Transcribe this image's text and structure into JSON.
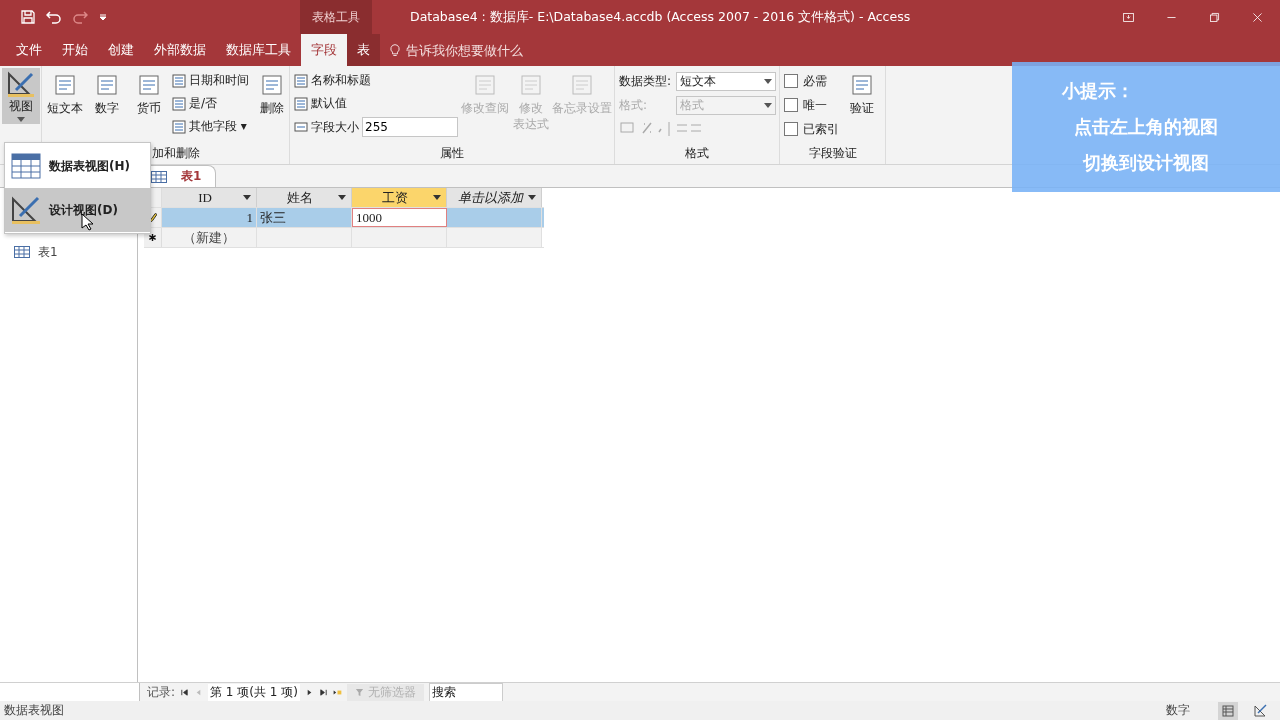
{
  "title_bar": {
    "context_group": "表格工具",
    "title": "Database4 : 数据库- E:\\Database4.accdb (Access 2007 - 2016 文件格式)  -  Access"
  },
  "ribbon_tabs": [
    {
      "label": "文件",
      "selected": false,
      "kind": "plain"
    },
    {
      "label": "开始",
      "selected": false,
      "kind": "plain"
    },
    {
      "label": "创建",
      "selected": false,
      "kind": "plain"
    },
    {
      "label": "外部数据",
      "selected": false,
      "kind": "plain"
    },
    {
      "label": "数据库工具",
      "selected": false,
      "kind": "plain"
    },
    {
      "label": "字段",
      "selected": true,
      "kind": "contextual"
    },
    {
      "label": "表",
      "selected": false,
      "kind": "contextual"
    }
  ],
  "tell_me": {
    "placeholder": "告诉我你想要做什么"
  },
  "ribbon_groups": [
    {
      "items": [
        {
          "kind": "split",
          "label": "视图",
          "disabled": false,
          "pressed": true
        }
      ]
    },
    {
      "label": "加和删除",
      "items": [
        {
          "kind": "large",
          "label": "短文本",
          "disabled": false
        },
        {
          "kind": "large",
          "label": "数字",
          "disabled": false
        },
        {
          "kind": "large",
          "label": "货币",
          "disabled": false
        },
        {
          "kind": "small",
          "label": "日期和时间",
          "disabled": false
        },
        {
          "kind": "small",
          "label": "是/否",
          "disabled": false
        },
        {
          "kind": "small",
          "label": "其他字段 ▾",
          "disabled": false
        },
        {
          "kind": "large",
          "label": "删除",
          "disabled": false
        }
      ]
    },
    {
      "label": "属性",
      "items": [
        {
          "kind": "small",
          "label": "名称和标题",
          "disabled": false
        },
        {
          "kind": "small",
          "label": "默认值",
          "disabled": false
        },
        {
          "kind": "field",
          "label": "字段大小",
          "value": "255",
          "disabled": false
        },
        {
          "kind": "large",
          "label": "修改查阅",
          "disabled": true
        },
        {
          "kind": "large",
          "lines": [
            "修改",
            "表达式"
          ],
          "disabled": true
        },
        {
          "kind": "large",
          "label": "备忘录设置",
          "disabled": true
        }
      ]
    },
    {
      "label": "格式",
      "items": [
        {
          "kind": "select",
          "label": "数据类型:",
          "value": "短文本",
          "disabled": false
        },
        {
          "kind": "select",
          "label": "格式:",
          "value": "格式",
          "disabled": true
        },
        {
          "kind": "format-buttons",
          "disabled": true
        }
      ]
    },
    {
      "label": "字段验证",
      "items": [
        {
          "kind": "check",
          "label": "必需",
          "checked": false
        },
        {
          "kind": "check",
          "label": "唯一",
          "checked": false
        },
        {
          "kind": "check",
          "label": "已索引",
          "checked": false
        },
        {
          "kind": "large",
          "label": "验证",
          "disabled": false
        }
      ]
    }
  ],
  "view_menu": [
    {
      "label": "数据表视图(H)",
      "selected": false
    },
    {
      "label": "设计视图(D)",
      "selected": true
    }
  ],
  "tip": [
    "小提示：",
    "点击左上角的视图",
    "切换到设计视图"
  ],
  "document_tabs": [
    {
      "label": "表1",
      "selected": true
    }
  ],
  "navigation_pane": {
    "items": [
      {
        "label": "表1"
      }
    ]
  },
  "table": {
    "columns": [
      {
        "label": "ID",
        "selected": false,
        "kind": "field"
      },
      {
        "label": "姓名",
        "selected": false,
        "kind": "field"
      },
      {
        "label": "工资",
        "selected": true,
        "kind": "field"
      },
      {
        "label": "单击以添加",
        "selected": false,
        "kind": "add"
      }
    ],
    "rows": [
      {
        "cells": [
          "1",
          "张三",
          "1000"
        ],
        "selected": true,
        "editing": true
      }
    ],
    "new_row": "（新建）"
  },
  "record_navigation": {
    "label": "记录:",
    "position": "第 1 项(共 1 项)",
    "filter": "无筛选器",
    "filter_disabled": true,
    "search": {
      "placeholder": "搜索"
    }
  },
  "status_bar": {
    "left": "数据表视图",
    "right": "数字"
  }
}
